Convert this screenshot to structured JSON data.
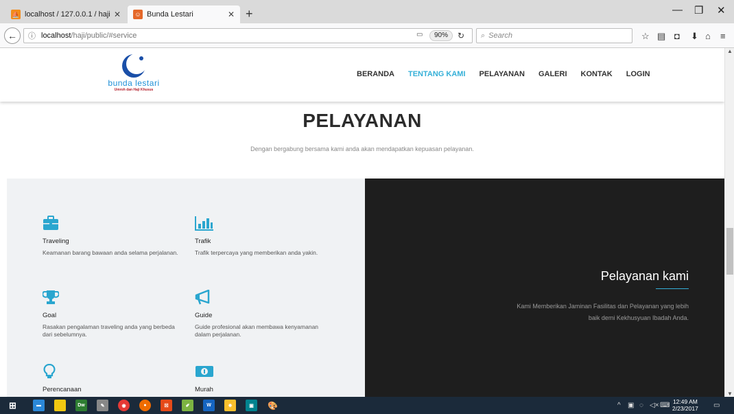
{
  "browser": {
    "tabs": [
      {
        "title": "localhost / 127.0.0.1 / haji ...",
        "active": false
      },
      {
        "title": "Bunda Lestari",
        "active": true
      }
    ],
    "url_host": "localhost",
    "url_path": "/haji/public/#service",
    "zoom": "90%",
    "search_placeholder": "Search"
  },
  "site": {
    "logo_name": "bunda lestari",
    "logo_tagline": "Umroh dan Haji Khusus",
    "menu": [
      {
        "label": "BERANDA",
        "active": false
      },
      {
        "label": "TENTANG KAMI",
        "active": true
      },
      {
        "label": "PELAYANAN",
        "active": false
      },
      {
        "label": "GALERI",
        "active": false
      },
      {
        "label": "KONTAK",
        "active": false
      },
      {
        "label": "LOGIN",
        "active": false
      }
    ],
    "section_title": "PELAYANAN",
    "section_subtitle": "Dengan bergabung bersama kami anda akan mendapatkan kepuasan pelayanan.",
    "features": [
      {
        "icon": "briefcase-icon",
        "title": "Traveling",
        "desc": "Keamanan barang bawaan anda selama perjalanan."
      },
      {
        "icon": "bar-chart-icon",
        "title": "Trafik",
        "desc": "Trafik terpercaya yang memberikan anda yakin."
      },
      {
        "icon": "trophy-icon",
        "title": "Goal",
        "desc": "Rasakan pengalaman traveling anda yang berbeda dari sebelumnya."
      },
      {
        "icon": "megaphone-icon",
        "title": "Guide",
        "desc": "Guide profesional akan membawa kenyamanan dalam perjalanan."
      },
      {
        "icon": "lightbulb-icon",
        "title": "Perencanaan",
        "desc": ""
      },
      {
        "icon": "money-icon",
        "title": "Murah",
        "desc": ""
      }
    ],
    "right_title": "Pelayanan kami",
    "right_desc": "Kami Memberikan Jaminan Fasilitas dan Pelayanan yang lebih baik demi Kekhusyuan Ibadah Anda."
  },
  "taskbar": {
    "time": "12:49 AM",
    "date": "2/23/2017"
  },
  "colors": {
    "accent": "#35b0d8",
    "dark_panel": "#1e1e1e",
    "light_panel": "#f0f2f4"
  }
}
